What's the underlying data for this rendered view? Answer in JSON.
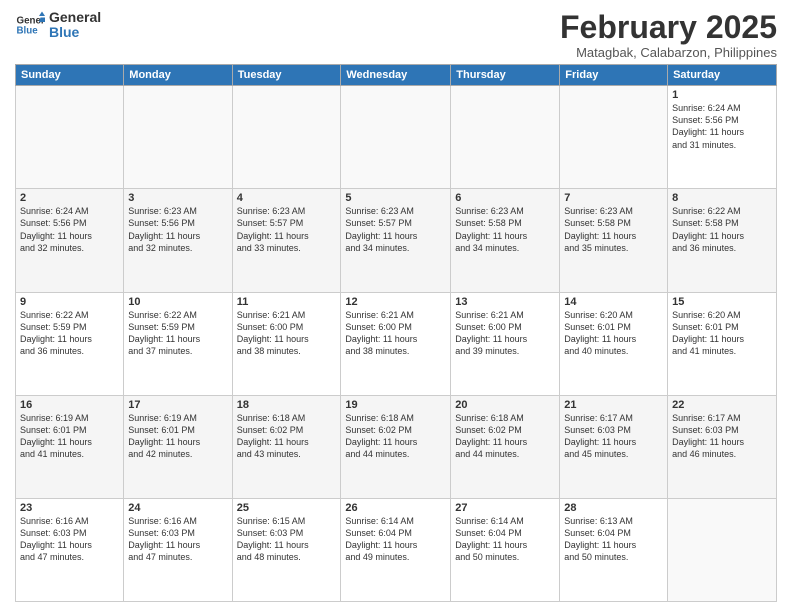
{
  "logo": {
    "line1": "General",
    "line2": "Blue"
  },
  "header": {
    "month": "February 2025",
    "location": "Matagbak, Calabarzon, Philippines"
  },
  "weekdays": [
    "Sunday",
    "Monday",
    "Tuesday",
    "Wednesday",
    "Thursday",
    "Friday",
    "Saturday"
  ],
  "weeks": [
    [
      {
        "day": "",
        "info": ""
      },
      {
        "day": "",
        "info": ""
      },
      {
        "day": "",
        "info": ""
      },
      {
        "day": "",
        "info": ""
      },
      {
        "day": "",
        "info": ""
      },
      {
        "day": "",
        "info": ""
      },
      {
        "day": "1",
        "info": "Sunrise: 6:24 AM\nSunset: 5:56 PM\nDaylight: 11 hours\nand 31 minutes."
      }
    ],
    [
      {
        "day": "2",
        "info": "Sunrise: 6:24 AM\nSunset: 5:56 PM\nDaylight: 11 hours\nand 32 minutes."
      },
      {
        "day": "3",
        "info": "Sunrise: 6:23 AM\nSunset: 5:56 PM\nDaylight: 11 hours\nand 32 minutes."
      },
      {
        "day": "4",
        "info": "Sunrise: 6:23 AM\nSunset: 5:57 PM\nDaylight: 11 hours\nand 33 minutes."
      },
      {
        "day": "5",
        "info": "Sunrise: 6:23 AM\nSunset: 5:57 PM\nDaylight: 11 hours\nand 34 minutes."
      },
      {
        "day": "6",
        "info": "Sunrise: 6:23 AM\nSunset: 5:58 PM\nDaylight: 11 hours\nand 34 minutes."
      },
      {
        "day": "7",
        "info": "Sunrise: 6:23 AM\nSunset: 5:58 PM\nDaylight: 11 hours\nand 35 minutes."
      },
      {
        "day": "8",
        "info": "Sunrise: 6:22 AM\nSunset: 5:58 PM\nDaylight: 11 hours\nand 36 minutes."
      }
    ],
    [
      {
        "day": "9",
        "info": "Sunrise: 6:22 AM\nSunset: 5:59 PM\nDaylight: 11 hours\nand 36 minutes."
      },
      {
        "day": "10",
        "info": "Sunrise: 6:22 AM\nSunset: 5:59 PM\nDaylight: 11 hours\nand 37 minutes."
      },
      {
        "day": "11",
        "info": "Sunrise: 6:21 AM\nSunset: 6:00 PM\nDaylight: 11 hours\nand 38 minutes."
      },
      {
        "day": "12",
        "info": "Sunrise: 6:21 AM\nSunset: 6:00 PM\nDaylight: 11 hours\nand 38 minutes."
      },
      {
        "day": "13",
        "info": "Sunrise: 6:21 AM\nSunset: 6:00 PM\nDaylight: 11 hours\nand 39 minutes."
      },
      {
        "day": "14",
        "info": "Sunrise: 6:20 AM\nSunset: 6:01 PM\nDaylight: 11 hours\nand 40 minutes."
      },
      {
        "day": "15",
        "info": "Sunrise: 6:20 AM\nSunset: 6:01 PM\nDaylight: 11 hours\nand 41 minutes."
      }
    ],
    [
      {
        "day": "16",
        "info": "Sunrise: 6:19 AM\nSunset: 6:01 PM\nDaylight: 11 hours\nand 41 minutes."
      },
      {
        "day": "17",
        "info": "Sunrise: 6:19 AM\nSunset: 6:01 PM\nDaylight: 11 hours\nand 42 minutes."
      },
      {
        "day": "18",
        "info": "Sunrise: 6:18 AM\nSunset: 6:02 PM\nDaylight: 11 hours\nand 43 minutes."
      },
      {
        "day": "19",
        "info": "Sunrise: 6:18 AM\nSunset: 6:02 PM\nDaylight: 11 hours\nand 44 minutes."
      },
      {
        "day": "20",
        "info": "Sunrise: 6:18 AM\nSunset: 6:02 PM\nDaylight: 11 hours\nand 44 minutes."
      },
      {
        "day": "21",
        "info": "Sunrise: 6:17 AM\nSunset: 6:03 PM\nDaylight: 11 hours\nand 45 minutes."
      },
      {
        "day": "22",
        "info": "Sunrise: 6:17 AM\nSunset: 6:03 PM\nDaylight: 11 hours\nand 46 minutes."
      }
    ],
    [
      {
        "day": "23",
        "info": "Sunrise: 6:16 AM\nSunset: 6:03 PM\nDaylight: 11 hours\nand 47 minutes."
      },
      {
        "day": "24",
        "info": "Sunrise: 6:16 AM\nSunset: 6:03 PM\nDaylight: 11 hours\nand 47 minutes."
      },
      {
        "day": "25",
        "info": "Sunrise: 6:15 AM\nSunset: 6:03 PM\nDaylight: 11 hours\nand 48 minutes."
      },
      {
        "day": "26",
        "info": "Sunrise: 6:14 AM\nSunset: 6:04 PM\nDaylight: 11 hours\nand 49 minutes."
      },
      {
        "day": "27",
        "info": "Sunrise: 6:14 AM\nSunset: 6:04 PM\nDaylight: 11 hours\nand 50 minutes."
      },
      {
        "day": "28",
        "info": "Sunrise: 6:13 AM\nSunset: 6:04 PM\nDaylight: 11 hours\nand 50 minutes."
      },
      {
        "day": "",
        "info": ""
      }
    ]
  ]
}
